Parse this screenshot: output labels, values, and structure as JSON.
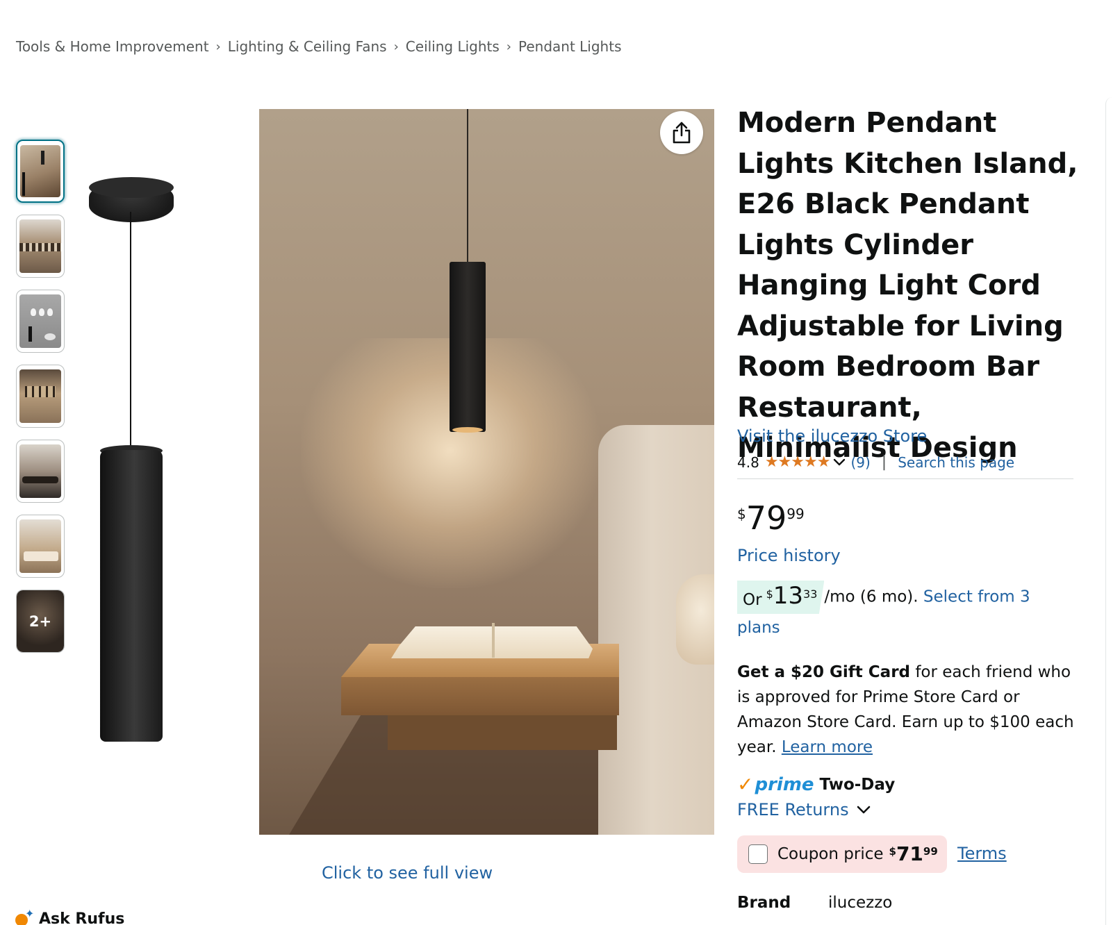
{
  "breadcrumb": {
    "items": [
      "Tools & Home Improvement",
      "Lighting & Ceiling Fans",
      "Ceiling Lights",
      "Pendant Lights"
    ],
    "separator": "›"
  },
  "gallery": {
    "more_count": "2+",
    "full_view_link": "Click to see full view",
    "share_icon": "share-icon"
  },
  "rufus": {
    "label": "Ask Rufus"
  },
  "product": {
    "title": "Modern Pendant Lights Kitchen Island, E26 Black Pendant Lights Cylinder Hanging Light Cord Adjustable for Living Room Bedroom Bar Restaurant, Minimalist Design",
    "store_link": "Visit the ilucezzo Store",
    "rating": "4.8",
    "stars": "★★★★★",
    "rating_count": "(9)",
    "search_page": "Search this page",
    "price_symbol": "$",
    "price_whole": "79",
    "price_fraction": "99",
    "price_history": "Price history",
    "monthly": {
      "or": "Or",
      "symbol": "$",
      "whole": "13",
      "fraction": "33",
      "suffix": "/mo (6 mo).",
      "select_plans": "Select from 3 plans"
    },
    "gift": {
      "bold": "Get a $20 Gift Card",
      "text": " for each friend who is approved for Prime Store Card or Amazon Store Card. Earn up to $100 each year.",
      "learn_more": "Learn more"
    },
    "prime": {
      "check": "✓",
      "word": "prime",
      "delivery": "Two-Day"
    },
    "returns": "FREE Returns",
    "coupon": {
      "label": "Coupon price",
      "symbol": "$",
      "whole": "71",
      "fraction": "99",
      "terms": "Terms"
    },
    "brand_label": "Brand",
    "brand_value": "ilucezzo"
  },
  "colors": {
    "link": "#2162a1",
    "star": "#de7921",
    "prime_blue": "#1f8fd6",
    "prime_orange": "#f08804",
    "monthly_badge": "#dff5ee",
    "coupon_bg": "#fbe2e2"
  }
}
